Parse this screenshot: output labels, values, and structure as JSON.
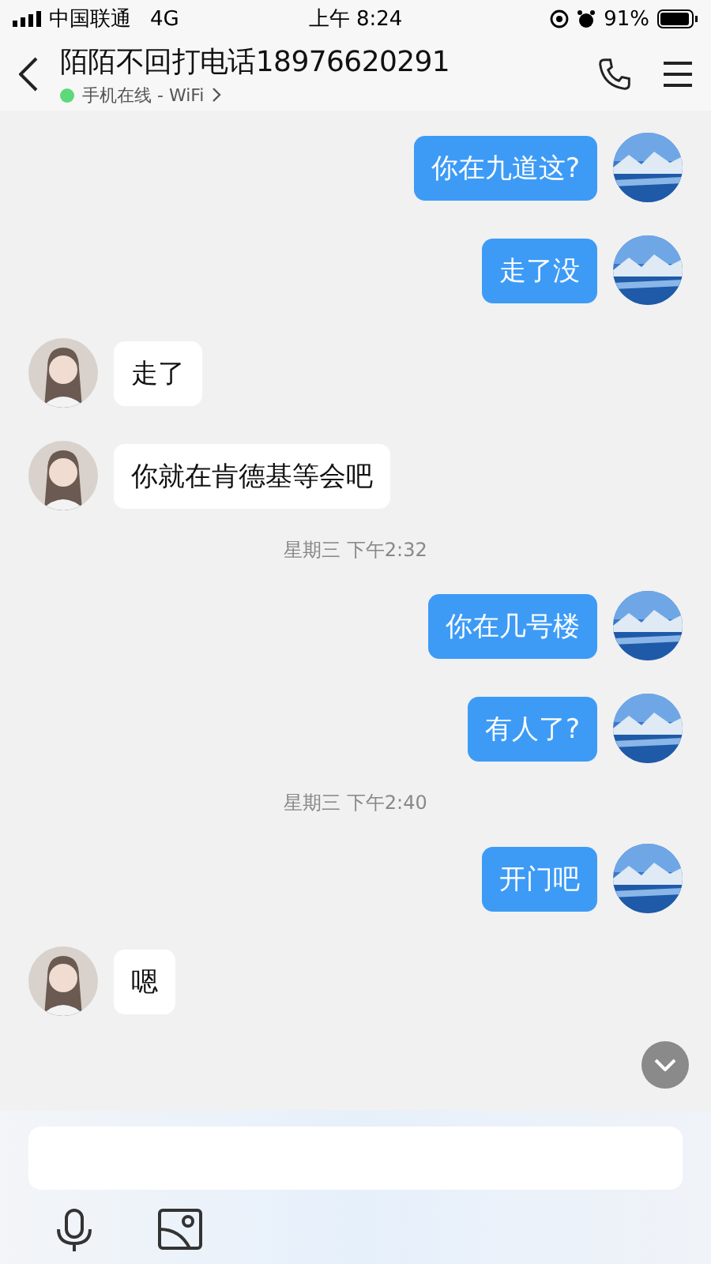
{
  "status_bar": {
    "carrier": "中国联通",
    "network": "4G",
    "time": "上午 8:24",
    "battery": "91%"
  },
  "header": {
    "title": "陌陌不回打电话18976620291",
    "status": "手机在线 - WiFi",
    "online": true
  },
  "messages": [
    {
      "kind": "outgoing",
      "text": "你在九道这?"
    },
    {
      "kind": "outgoing",
      "text": "走了没"
    },
    {
      "kind": "incoming",
      "text": "走了"
    },
    {
      "kind": "incoming",
      "text": "你就在肯德基等会吧"
    },
    {
      "kind": "timestamp",
      "text": "星期三 下午2:32"
    },
    {
      "kind": "outgoing",
      "text": "你在几号楼"
    },
    {
      "kind": "outgoing",
      "text": "有人了?"
    },
    {
      "kind": "timestamp",
      "text": "星期三 下午2:40"
    },
    {
      "kind": "outgoing",
      "text": "开门吧"
    },
    {
      "kind": "incoming",
      "text": "嗯"
    }
  ]
}
